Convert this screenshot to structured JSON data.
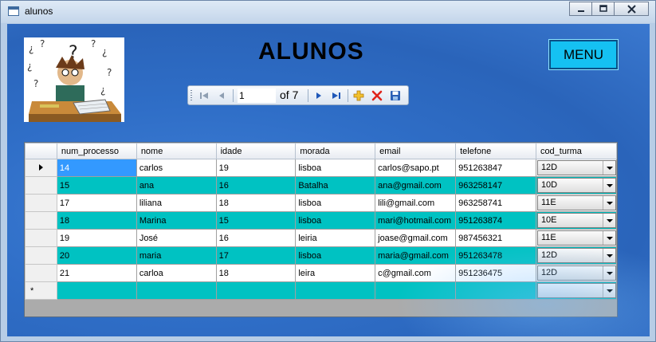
{
  "window": {
    "title": "alunos",
    "controls": {
      "minimize": "‒",
      "maximize": "□",
      "close": "✕"
    }
  },
  "header": {
    "title": "ALUNOS",
    "menu_label": "MENU"
  },
  "navigator": {
    "position": "1",
    "count": "of 7"
  },
  "grid": {
    "columns": [
      "num_processo",
      "nome",
      "idade",
      "morada",
      "email",
      "telefone",
      "cod_turma"
    ],
    "rows": [
      {
        "num_processo": "14",
        "nome": "carlos",
        "idade": "19",
        "morada": "lisboa",
        "email": "carlos@sapo.pt",
        "telefone": "951263847",
        "cod_turma": "12D"
      },
      {
        "num_processo": "15",
        "nome": "ana",
        "idade": "16",
        "morada": "Batalha",
        "email": "ana@gmail.com",
        "telefone": "963258147",
        "cod_turma": "10D"
      },
      {
        "num_processo": "17",
        "nome": "liliana",
        "idade": "18",
        "morada": "lisboa",
        "email": "lili@gmail.com",
        "telefone": "963258741",
        "cod_turma": "11E"
      },
      {
        "num_processo": "18",
        "nome": "Marina",
        "idade": "15",
        "morada": "lisboa",
        "email": "mari@hotmail.com",
        "telefone": "951263874",
        "cod_turma": "10E"
      },
      {
        "num_processo": "19",
        "nome": "José",
        "idade": "16",
        "morada": "leiria",
        "email": "joase@gmail.com",
        "telefone": "987456321",
        "cod_turma": "11E"
      },
      {
        "num_processo": "20",
        "nome": "maria",
        "idade": "17",
        "morada": "lisboa",
        "email": "maria@gmail.com",
        "telefone": "951263478",
        "cod_turma": "12D"
      },
      {
        "num_processo": "21",
        "nome": "carloa",
        "idade": "18",
        "morada": "leira",
        "email": "c@gmail.com",
        "telefone": "951236475",
        "cod_turma": "12D"
      }
    ],
    "new_row_marker": "*"
  },
  "colors": {
    "teal_row": "#00c2c2",
    "selected_cell": "#3399ff",
    "menu_button": "#15c1f2",
    "background": "#2f6ec7"
  },
  "icons": {
    "move_first": "move-first-icon",
    "move_previous": "move-previous-icon",
    "move_next": "move-next-icon",
    "move_last": "move-last-icon",
    "add_new": "add-new-icon",
    "delete": "delete-icon",
    "save": "save-icon"
  }
}
